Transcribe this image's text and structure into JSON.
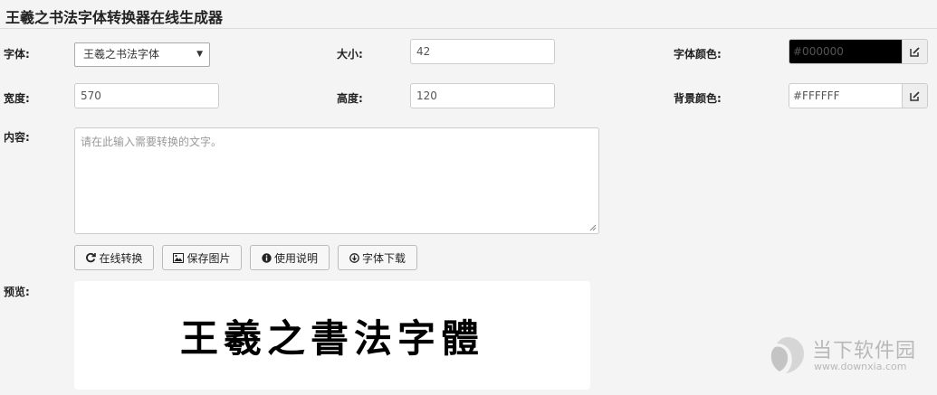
{
  "page": {
    "title": "王羲之书法字体转换器在线生成器"
  },
  "form": {
    "font_label": "字体:",
    "font_selected": "王羲之书法字体",
    "size_label": "大小:",
    "size_value": "42",
    "font_color_label": "字体颜色:",
    "font_color_value": "#000000",
    "width_label": "宽度:",
    "width_value": "570",
    "height_label": "高度:",
    "height_value": "120",
    "bg_color_label": "背景颜色:",
    "bg_color_value": "#FFFFFF",
    "content_label": "内容:",
    "content_placeholder": "请在此输入需要转换的文字。"
  },
  "buttons": {
    "convert": "在线转换",
    "save_image": "保存图片",
    "instructions": "使用说明",
    "download_font": "字体下载"
  },
  "preview": {
    "label": "预览:",
    "rendered_text": "王羲之書法字體"
  },
  "watermark": {
    "brand": "当下软件园",
    "url": "www.downxia.com"
  },
  "colors": {
    "font_color_swatch": "#000000",
    "bg_color_swatch": "#FFFFFF",
    "page_bg": "#f4f4f4"
  },
  "icons": [
    "edit-icon",
    "refresh-icon",
    "image-icon",
    "info-icon",
    "download-icon",
    "select-arrow-icon",
    "resize-grip-icon",
    "watermark-logo-icon"
  ]
}
